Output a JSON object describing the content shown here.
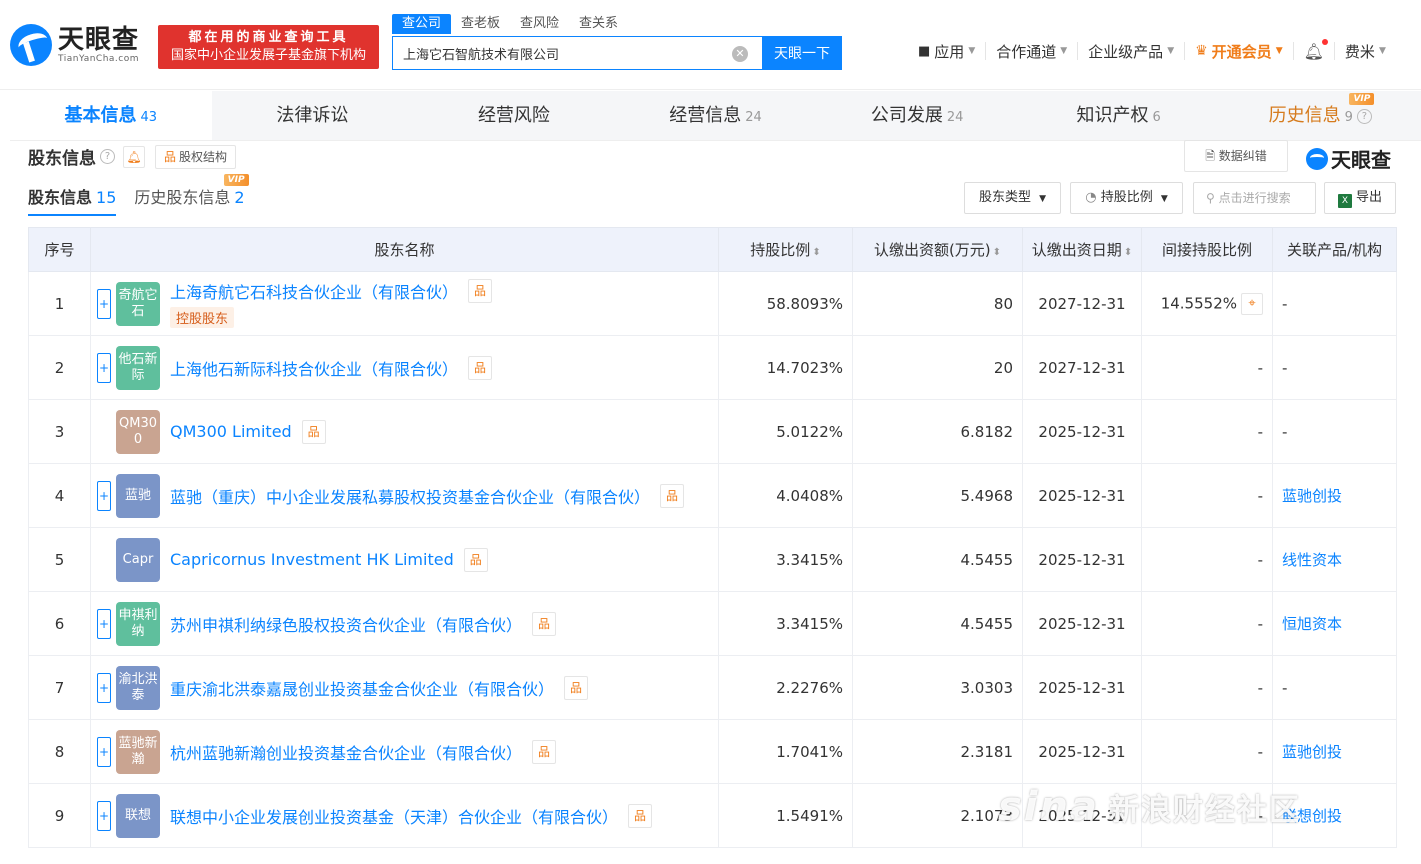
{
  "header": {
    "logo_cn": "天眼查",
    "logo_en": "TianYanCha.com",
    "promo_line1": "都在用的商业查询工具",
    "promo_line2": "国家中小企业发展子基金旗下机构",
    "search_tabs": [
      "查公司",
      "查老板",
      "查风险",
      "查关系"
    ],
    "search_value": "上海它石智航技术有限公司",
    "search_button": "天眼一下",
    "nav": {
      "apps": "应用",
      "cooperation": "合作通道",
      "enterprise": "企业级产品",
      "vip": "开通会员",
      "user": "费米"
    }
  },
  "main_tabs": [
    {
      "label": "基本信息",
      "count": "43"
    },
    {
      "label": "法律诉讼",
      "count": ""
    },
    {
      "label": "经营风险",
      "count": ""
    },
    {
      "label": "经营信息",
      "count": "24"
    },
    {
      "label": "公司发展",
      "count": "24"
    },
    {
      "label": "知识产权",
      "count": "6"
    },
    {
      "label": "历史信息",
      "count": "9",
      "badge": "VIP"
    }
  ],
  "section": {
    "title": "股东信息",
    "structure_button": "股权结构",
    "correct_button": "数据纠错",
    "brand": "天眼查"
  },
  "sub_tabs": [
    {
      "label": "股东信息",
      "count": "15"
    },
    {
      "label": "历史股东信息",
      "count": "2",
      "badge": "VIP"
    }
  ],
  "filters": {
    "type": "股东类型",
    "ratio": "持股比例",
    "search_placeholder": "点击进行搜索",
    "export": "导出"
  },
  "table": {
    "headers": [
      "序号",
      "股东名称",
      "持股比例",
      "认缴出资额(万元)",
      "认缴出资日期",
      "间接持股比例",
      "关联产品/机构"
    ],
    "rows": [
      {
        "idx": "1",
        "avatar": "奇航它石",
        "avatar_color": "#5fbf9d",
        "expand": true,
        "name": "上海奇航它石科技合伙企业（有限合伙）",
        "tag": "控股股东",
        "ratio": "58.8093%",
        "amount": "80",
        "date": "2027-12-31",
        "indirect": "14.5552%",
        "related": "-",
        "related_link": false
      },
      {
        "idx": "2",
        "avatar": "他石新际",
        "avatar_color": "#5fbf9d",
        "expand": true,
        "name": "上海他石新际科技合伙企业（有限合伙）",
        "tag": "",
        "ratio": "14.7023%",
        "amount": "20",
        "date": "2027-12-31",
        "indirect": "-",
        "related": "-",
        "related_link": false
      },
      {
        "idx": "3",
        "avatar": "QM300",
        "avatar_color": "#c9a491",
        "expand": false,
        "name": "QM300 Limited",
        "tag": "",
        "ratio": "5.0122%",
        "amount": "6.8182",
        "date": "2025-12-31",
        "indirect": "-",
        "related": "-",
        "related_link": false
      },
      {
        "idx": "4",
        "avatar": "蓝驰",
        "avatar_color": "#7b95c8",
        "expand": true,
        "name": "蓝驰（重庆）中小企业发展私募股权投资基金合伙企业（有限合伙）",
        "tag": "",
        "ratio": "4.0408%",
        "amount": "5.4968",
        "date": "2025-12-31",
        "indirect": "-",
        "related": "蓝驰创投",
        "related_link": true
      },
      {
        "idx": "5",
        "avatar": "Capr",
        "avatar_color": "#7b95c8",
        "expand": false,
        "name": "Capricornus Investment HK Limited",
        "tag": "",
        "ratio": "3.3415%",
        "amount": "4.5455",
        "date": "2025-12-31",
        "indirect": "-",
        "related": "线性资本",
        "related_link": true
      },
      {
        "idx": "6",
        "avatar": "申祺利纳",
        "avatar_color": "#5fbf9d",
        "expand": true,
        "name": "苏州申祺利纳绿色股权投资合伙企业（有限合伙）",
        "tag": "",
        "ratio": "3.3415%",
        "amount": "4.5455",
        "date": "2025-12-31",
        "indirect": "-",
        "related": "恒旭资本",
        "related_link": true
      },
      {
        "idx": "7",
        "avatar": "渝北洪泰",
        "avatar_color": "#7b95c8",
        "expand": true,
        "name": "重庆渝北洪泰嘉晟创业投资基金合伙企业（有限合伙）",
        "tag": "",
        "ratio": "2.2276%",
        "amount": "3.0303",
        "date": "2025-12-31",
        "indirect": "-",
        "related": "-",
        "related_link": false
      },
      {
        "idx": "8",
        "avatar": "蓝驰新瀚",
        "avatar_color": "#c9a491",
        "expand": true,
        "name": "杭州蓝驰新瀚创业投资基金合伙企业（有限合伙）",
        "tag": "",
        "ratio": "1.7041%",
        "amount": "2.3181",
        "date": "2025-12-31",
        "indirect": "-",
        "related": "蓝驰创投",
        "related_link": true
      },
      {
        "idx": "9",
        "avatar": "联想",
        "avatar_color": "#7b95c8",
        "expand": true,
        "name": "联想中小企业发展创业投资基金（天津）合伙企业（有限合伙）",
        "tag": "",
        "ratio": "1.5491%",
        "amount": "2.1073",
        "date": "2025-12-31",
        "indirect": "-",
        "related": "联想创投",
        "related_link": true
      }
    ]
  },
  "watermark": {
    "logo": "sina",
    "text": "新浪财经社区"
  },
  "colors": {
    "accent": "#0b84ff",
    "promo": "#e0332e",
    "vip": "#f07d1a"
  }
}
